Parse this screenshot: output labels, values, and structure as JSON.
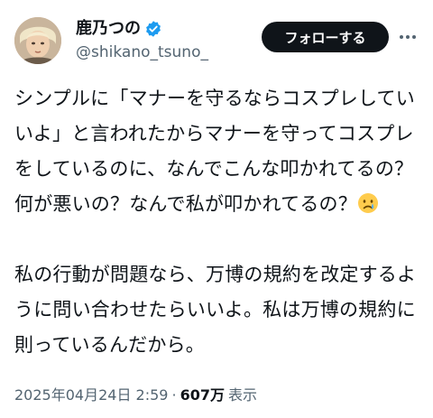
{
  "author": {
    "display_name": "鹿乃つの",
    "handle": "@shikano_tsuno_",
    "verified": true
  },
  "actions": {
    "follow_label": "フォローする",
    "more_icon": "more-icon"
  },
  "tweet": {
    "paragraph_1": "シンプルに「マナーを守るならコスプレしていいよ」と言われたからマナーを守ってコスプレをしているのに、なんでこんな叩かれてるの？何が悪いの？なんで私が叩かれてるの？",
    "paragraph_1_emoji": "crying-face-emoji",
    "paragraph_2": "私の行動が問題なら、万博の規約を改定するように問い合わせたらいいよ。私は万博の規約に則っているんだから。"
  },
  "meta": {
    "timestamp": "2025年04月24日 2:59",
    "separator": "·",
    "views": "607万",
    "views_label": "表示"
  },
  "colors": {
    "text": "#0f1419",
    "secondary": "#536471",
    "verified_blue": "#1d9bf0",
    "follow_bg": "#0f1419"
  }
}
